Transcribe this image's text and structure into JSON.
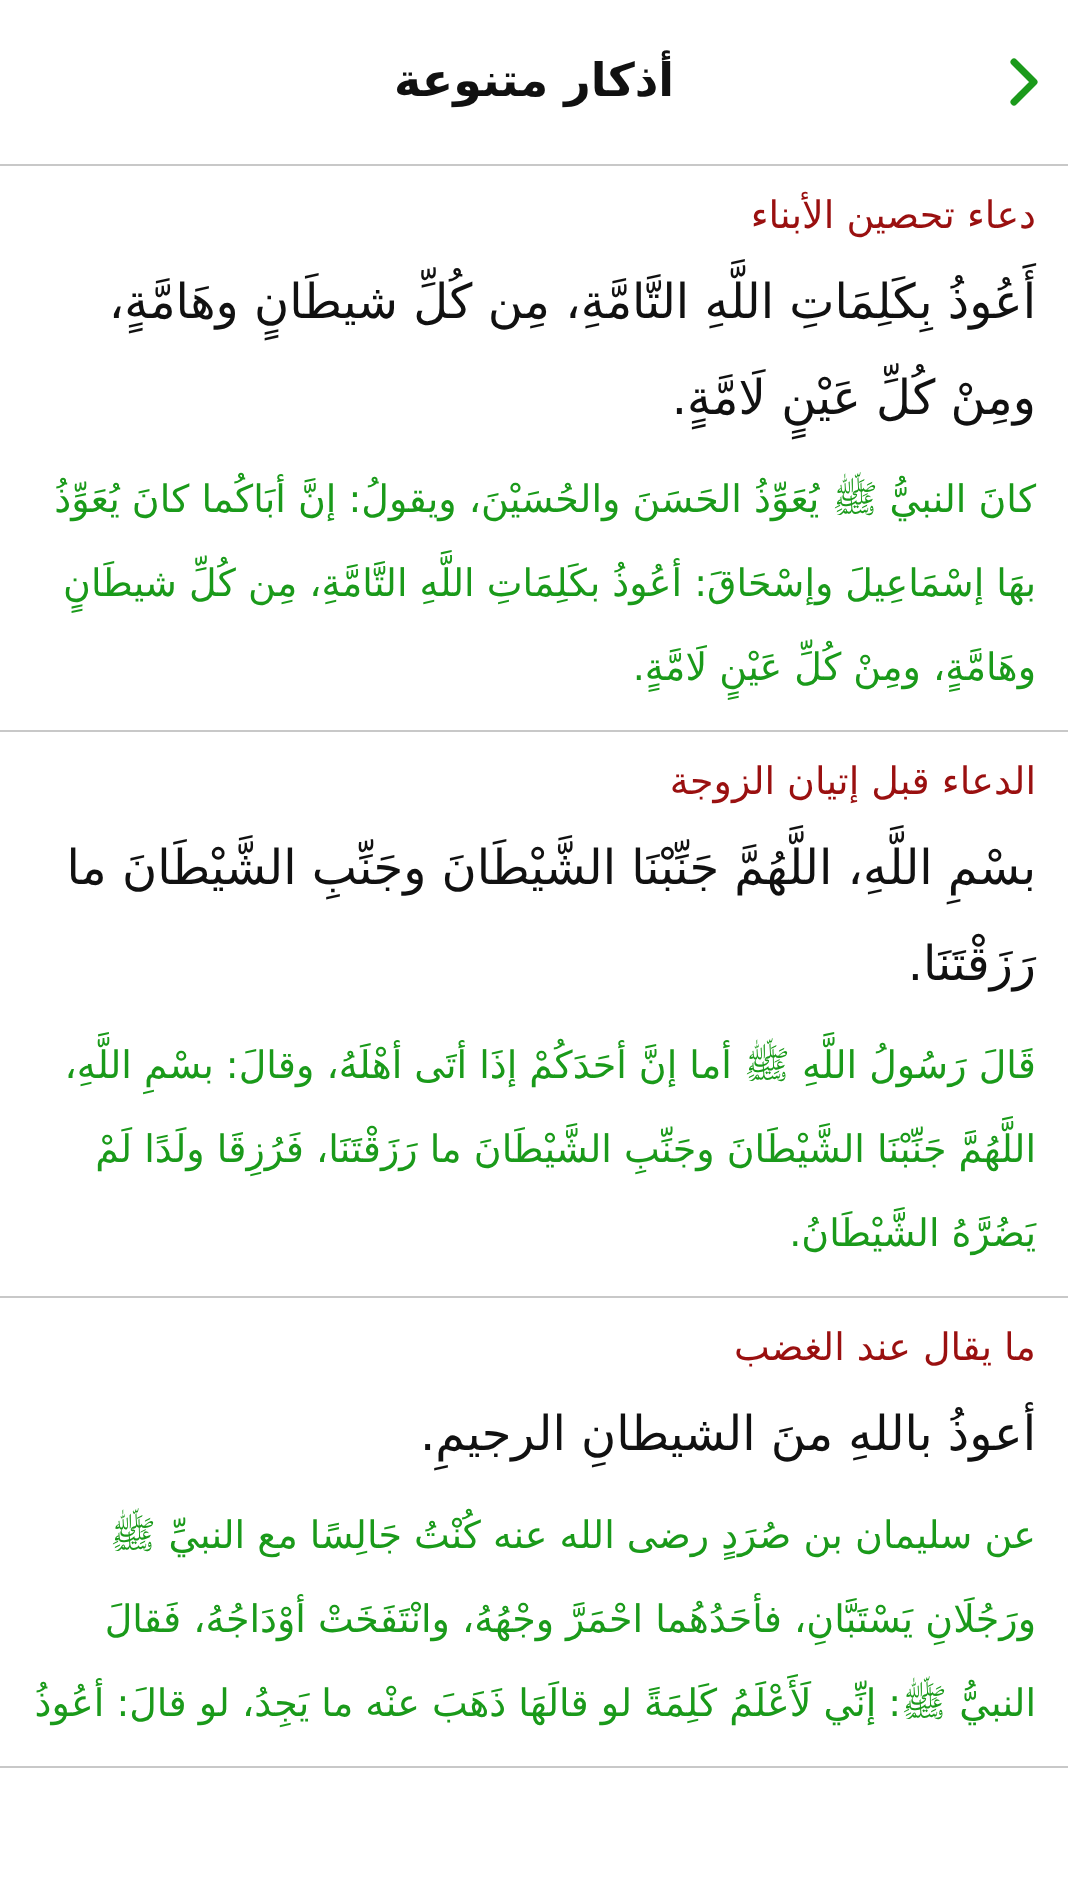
{
  "header": {
    "title": "أذكار متنوعة"
  },
  "sections": [
    {
      "title": "دعاء تحصين الأبناء",
      "dua": "أَعُوذُ بِكَلِمَاتِ اللَّهِ التَّامَّةِ، مِن كُلِّ شيطَانٍ وهَامَّةٍ، ومِنْ كُلِّ عَيْنٍ لَامَّةٍ.",
      "note": "كانَ النبيُّ ﷺ يُعَوِّذُ الحَسَنَ والحُسَيْنَ، ويقولُ: إنَّ أبَاكُما كانَ يُعَوِّذُ بهَا إسْمَاعِيلَ وإسْحَاقَ: أعُوذُ بكَلِمَاتِ اللَّهِ التَّامَّةِ، مِن كُلِّ شيطَانٍ وهَامَّةٍ، ومِنْ كُلِّ عَيْنٍ لَامَّةٍ."
    },
    {
      "title": "الدعاء قبل إتيان الزوجة",
      "dua": "بسْمِ اللَّهِ، اللَّهُمَّ جَنِّبْنَا الشَّيْطَانَ وجَنِّبِ الشَّيْطَانَ ما رَزَقْتَنَا.",
      "note": "قَالَ رَسُولُ اللَّهِ ﷺ أما إنَّ أحَدَكُمْ إذَا أتَى أهْلَهُ، وقالَ: بسْمِ اللَّهِ، اللَّهُمَّ جَنِّبْنَا الشَّيْطَانَ وجَنِّبِ الشَّيْطَانَ ما رَزَقْتَنَا، فَرُزِقَا ولَدًا لَمْ يَضُرَّهُ الشَّيْطَانُ."
    },
    {
      "title": "ما يقال عند الغضب",
      "dua": "أعوذُ باللهِ منَ الشيطانِ الرجيمِ.",
      "note": "عن سليمان بن صُرَدٍ رضى الله عنه كُنْتُ جَالِسًا مع النبيِّ ﷺ ورَجُلَانِ يَسْتَبَّانِ، فأحَدُهُما احْمَرَّ وجْهُهُ، وانْتَفَخَتْ أوْدَاجُهُ، فَقالَ النبيُّ ﷺ: إنِّي لَأَعْلَمُ كَلِمَةً لو قالَهَا ذَهَبَ عنْه ما يَجِدُ، لو قالَ: أعُوذُ"
    }
  ]
}
